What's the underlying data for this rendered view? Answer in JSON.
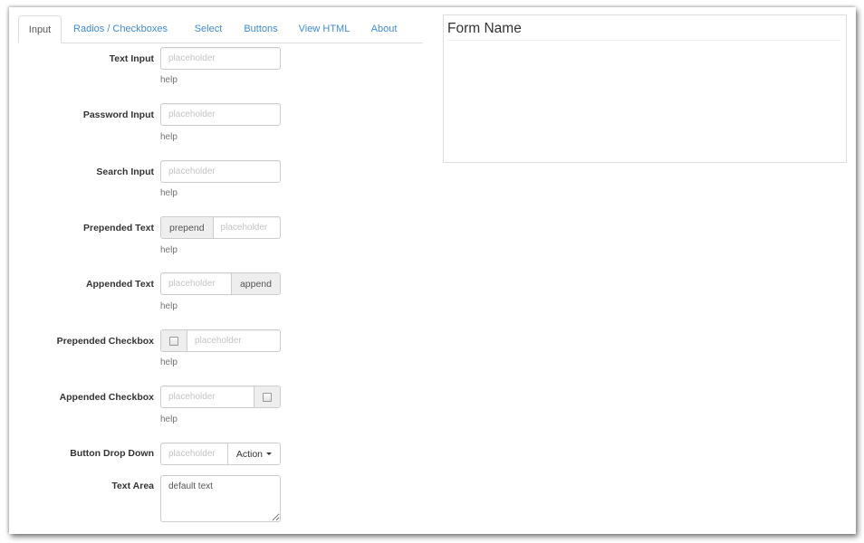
{
  "tabs": [
    {
      "label": "Input",
      "active": true
    },
    {
      "label": "Radios / Checkboxes",
      "active": false
    },
    {
      "label": "Select",
      "active": false
    },
    {
      "label": "Buttons",
      "active": false
    },
    {
      "label": "View HTML",
      "active": false
    },
    {
      "label": "About",
      "active": false
    }
  ],
  "fields": {
    "text_input": {
      "label": "Text Input",
      "placeholder": "placeholder",
      "help": "help"
    },
    "password_input": {
      "label": "Password Input",
      "placeholder": "placeholder",
      "help": "help"
    },
    "search_input": {
      "label": "Search Input",
      "placeholder": "placeholder",
      "help": "help"
    },
    "prepended_text": {
      "label": "Prepended Text",
      "addon": "prepend",
      "placeholder": "placeholder",
      "help": "help"
    },
    "appended_text": {
      "label": "Appended Text",
      "addon": "append",
      "placeholder": "placeholder",
      "help": "help"
    },
    "prepended_checkbox": {
      "label": "Prepended Checkbox",
      "placeholder": "placeholder",
      "help": "help"
    },
    "appended_checkbox": {
      "label": "Appended Checkbox",
      "placeholder": "placeholder",
      "help": "help"
    },
    "button_dropdown": {
      "label": "Button Drop Down",
      "placeholder": "placeholder",
      "button_label": "Action"
    },
    "text_area": {
      "label": "Text Area",
      "value": "default text"
    }
  },
  "form_preview": {
    "legend": "Form Name"
  }
}
